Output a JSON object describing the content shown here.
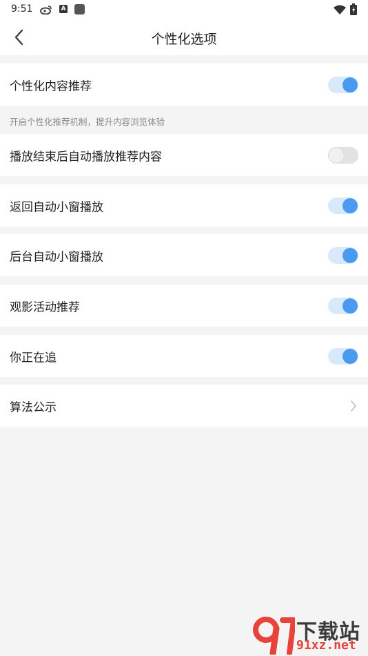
{
  "status_bar": {
    "time": "9:51",
    "icons": [
      "weibo-icon",
      "a-icon",
      "square-icon",
      "wifi-icon",
      "battery-icon"
    ]
  },
  "nav": {
    "title": "个性化选项",
    "back_icon": "chevron-left-icon"
  },
  "settings": [
    {
      "label": "个性化内容推荐",
      "toggle": true
    },
    {
      "label": "播放结束后自动播放推荐内容",
      "toggle": false
    },
    {
      "label": "返回自动小窗播放",
      "toggle": true
    },
    {
      "label": "后台自动小窗播放",
      "toggle": true
    },
    {
      "label": "观影活动推荐",
      "toggle": true
    },
    {
      "label": "你正在追",
      "toggle": true
    }
  ],
  "helper_text": "开启个性化推荐机制，提升内容浏览体验",
  "link_row": {
    "label": "算法公示",
    "icon": "chevron-right-icon"
  },
  "watermark": {
    "cn": "下载站",
    "url": "91xz.net"
  },
  "colors": {
    "accent": "#4a9af0",
    "toggle_on_track": "#d8e9fb",
    "toggle_off_track": "#e2e2e4",
    "background": "#f4f4f5"
  }
}
